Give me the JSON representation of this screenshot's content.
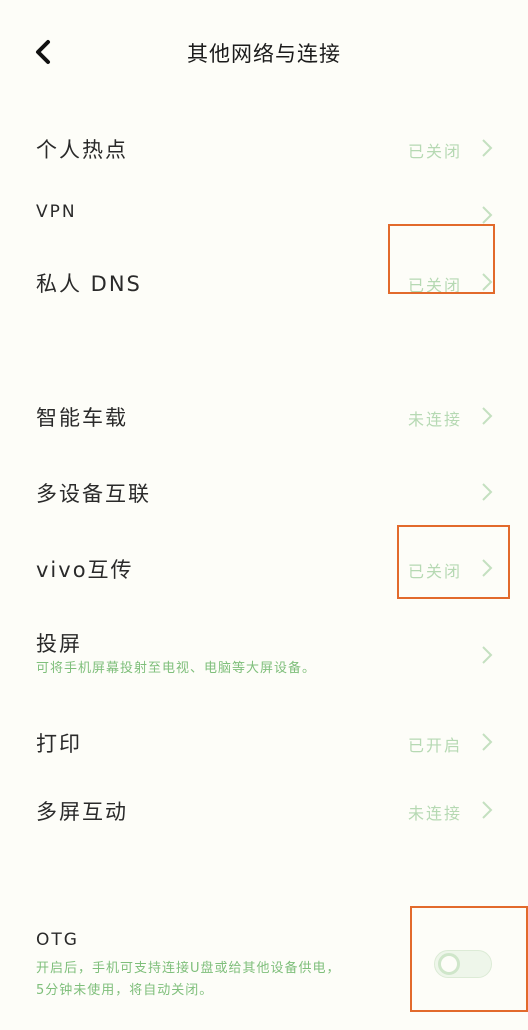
{
  "header": {
    "title": "其他网络与连接"
  },
  "rows": [
    {
      "label": "个人热点",
      "status": "已关闭"
    },
    {
      "label": "VPN",
      "status": ""
    },
    {
      "label": "私人 DNS",
      "status": "已关闭"
    },
    {
      "label": "智能车载",
      "status": "未连接"
    },
    {
      "label": "多设备互联",
      "status": ""
    },
    {
      "label": "vivo互传",
      "status": "已关闭"
    },
    {
      "label": "投屏",
      "sub": "可将手机屏幕投射至电视、电脑等大屏设备。",
      "status": ""
    },
    {
      "label": "打印",
      "status": "已开启"
    },
    {
      "label": "多屏互动",
      "status": "未连接"
    }
  ],
  "otg": {
    "label": "OTG",
    "desc_line1": "开启后，手机可支持连接U盘或给其他设备供电，",
    "desc_line2": "5分钟未使用，将自动关闭。",
    "enabled": false
  },
  "colors": {
    "accent": "#7fbf7b",
    "status": "#b6d9b3",
    "highlight": "#e26a2c"
  }
}
